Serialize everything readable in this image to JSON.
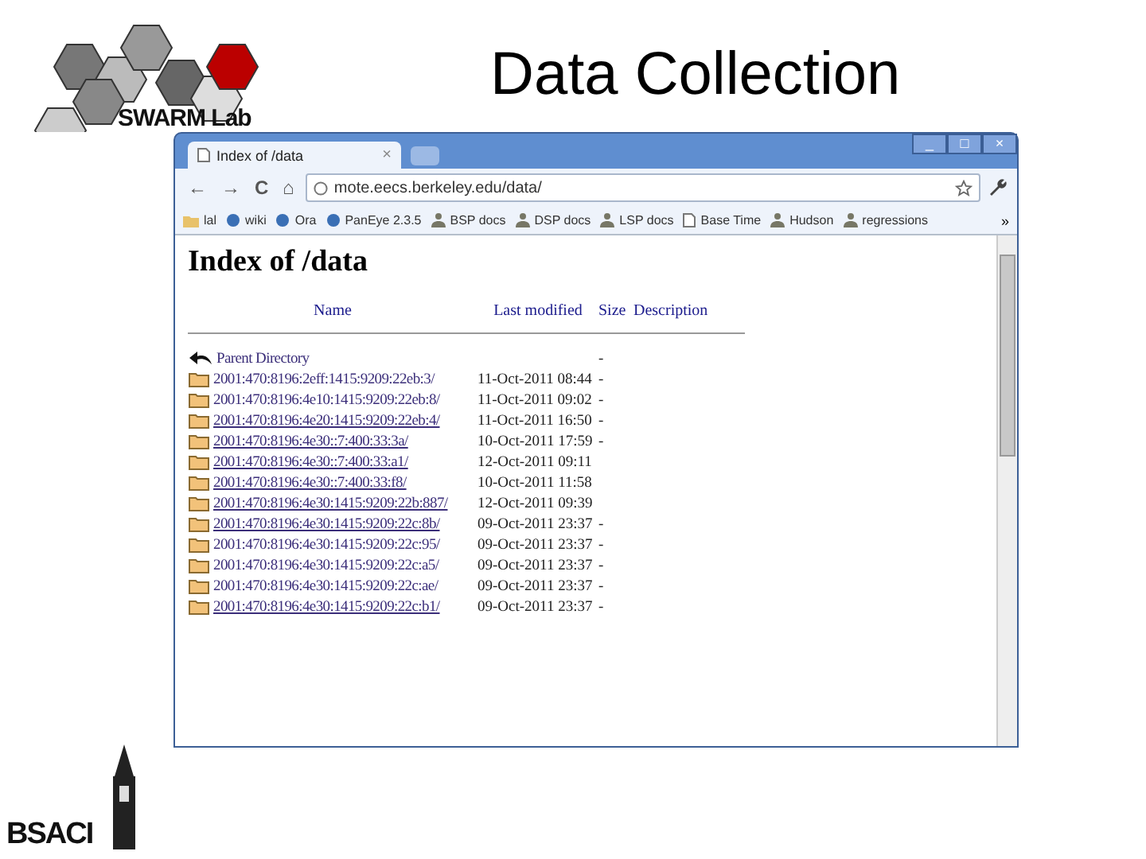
{
  "slide": {
    "title": "Data Collection",
    "logo_text": "SWARM Lab",
    "footer_logo_text": "BSACI"
  },
  "browser": {
    "tab": {
      "title": "Index of /data",
      "close": "×"
    },
    "window_controls": [
      "_",
      "□",
      "×"
    ],
    "nav": [
      "←",
      "→",
      "C",
      "⌂"
    ],
    "url": "mote.eecs.berkeley.edu/data/",
    "bookmarks": [
      {
        "kind": "folder",
        "label": "lal"
      },
      {
        "kind": "site",
        "label": "wiki"
      },
      {
        "kind": "site",
        "label": "Ora"
      },
      {
        "kind": "site",
        "label": "PanEye 2.3.5"
      },
      {
        "kind": "person",
        "label": "BSP docs"
      },
      {
        "kind": "person",
        "label": "DSP docs"
      },
      {
        "kind": "person",
        "label": "LSP docs"
      },
      {
        "kind": "page",
        "label": "Base Time"
      },
      {
        "kind": "person",
        "label": "Hudson"
      },
      {
        "kind": "person",
        "label": "regressions"
      }
    ],
    "more": "»"
  },
  "page": {
    "heading": "Index of /data",
    "columns": [
      "Name",
      "Last modified",
      "Size",
      "Description"
    ],
    "rows": [
      {
        "kind": "parent",
        "name": "Parent Directory",
        "modified": "",
        "size": "-",
        "underlined": false
      },
      {
        "kind": "folder",
        "name": "2001:470:8196:2eff:1415:9209:22eb:3/",
        "modified": "11-Oct-2011 08:44",
        "size": "-",
        "underlined": false
      },
      {
        "kind": "folder",
        "name": "2001:470:8196:4e10:1415:9209:22eb:8/",
        "modified": "11-Oct-2011 09:02",
        "size": "-",
        "underlined": false
      },
      {
        "kind": "folder",
        "name": "2001:470:8196:4e20:1415:9209:22eb:4/",
        "modified": "11-Oct-2011 16:50",
        "size": "-",
        "underlined": true
      },
      {
        "kind": "folder",
        "name": "2001:470:8196:4e30::7:400:33:3a/",
        "modified": "10-Oct-2011 17:59",
        "size": "-",
        "underlined": true
      },
      {
        "kind": "folder",
        "name": "2001:470:8196:4e30::7:400:33:a1/",
        "modified": "12-Oct-2011 09:11",
        "size": "",
        "underlined": true
      },
      {
        "kind": "folder",
        "name": "2001:470:8196:4e30::7:400:33:f8/",
        "modified": "10-Oct-2011 11:58",
        "size": "",
        "underlined": true
      },
      {
        "kind": "folder",
        "name": "2001:470:8196:4e30:1415:9209:22b:887/",
        "modified": "12-Oct-2011 09:39",
        "size": "",
        "underlined": true
      },
      {
        "kind": "folder",
        "name": "2001:470:8196:4e30:1415:9209:22c:8b/",
        "modified": "09-Oct-2011 23:37",
        "size": "-",
        "underlined": true
      },
      {
        "kind": "folder",
        "name": "2001:470:8196:4e30:1415:9209:22c:95/",
        "modified": "09-Oct-2011 23:37",
        "size": "-",
        "underlined": false
      },
      {
        "kind": "folder",
        "name": "2001:470:8196:4e30:1415:9209:22c:a5/",
        "modified": "09-Oct-2011 23:37",
        "size": "-",
        "underlined": false
      },
      {
        "kind": "folder",
        "name": "2001:470:8196:4e30:1415:9209:22c:ae/",
        "modified": "09-Oct-2011 23:37",
        "size": "-",
        "underlined": false
      },
      {
        "kind": "folder",
        "name": "2001:470:8196:4e30:1415:9209:22c:b1/",
        "modified": "09-Oct-2011 23:37",
        "size": "-",
        "underlined": true
      }
    ]
  }
}
